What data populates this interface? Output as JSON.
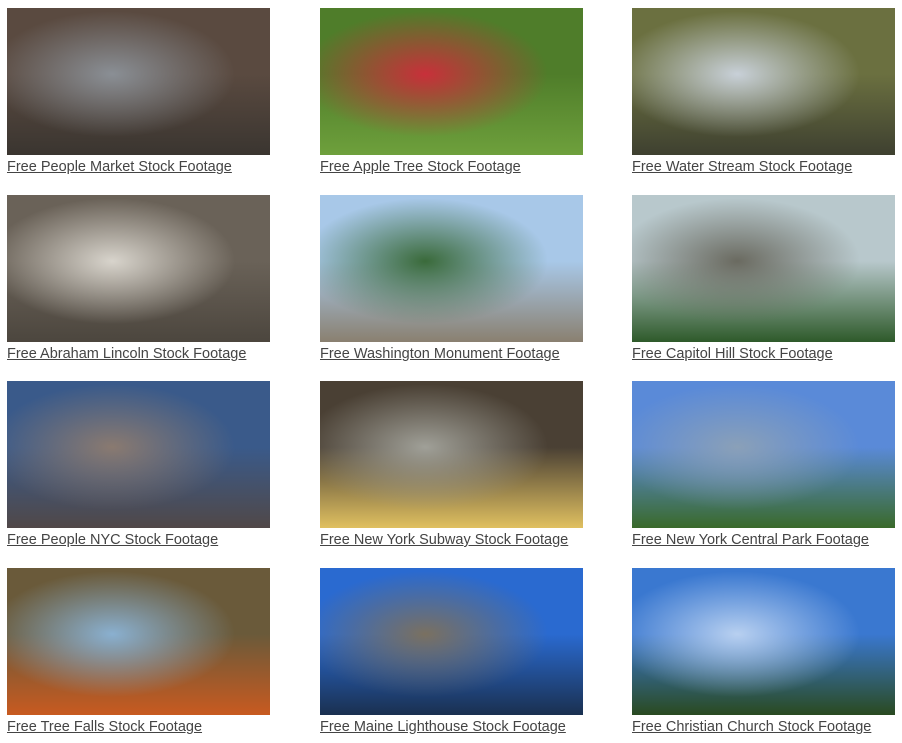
{
  "items": [
    {
      "title": "Free People Market Stock Footage",
      "colors": [
        "#5a4a40",
        "#8a8f95",
        "#3a3530"
      ]
    },
    {
      "title": "Free Apple Tree Stock Footage",
      "colors": [
        "#4f7d2a",
        "#c8303a",
        "#6ea03c"
      ]
    },
    {
      "title": "Free Water Stream Stock Footage",
      "colors": [
        "#6b7040",
        "#c8d0d8",
        "#3e4030"
      ]
    },
    {
      "title": "Free Abraham Lincoln Stock Footage",
      "colors": [
        "#6a6258",
        "#d8d4cc",
        "#4c463e"
      ]
    },
    {
      "title": "Free Washington Monument Footage",
      "colors": [
        "#a8c8e8",
        "#3a6a3a",
        "#8a8070"
      ]
    },
    {
      "title": "Free Capitol Hill Stock Footage",
      "colors": [
        "#b8c8cc",
        "#6a6a60",
        "#2e5a2a"
      ]
    },
    {
      "title": "Free People NYC Stock Footage",
      "colors": [
        "#3a5a8a",
        "#8a7a70",
        "#504848"
      ]
    },
    {
      "title": "Free New York Subway Stock Footage",
      "colors": [
        "#4a4034",
        "#a0a098",
        "#e0c060"
      ]
    },
    {
      "title": "Free New York Central Park Footage",
      "colors": [
        "#5a8ad8",
        "#8aa0b8",
        "#3a6a2a"
      ]
    },
    {
      "title": "Free Tree Falls Stock Footage",
      "colors": [
        "#6a5a3a",
        "#8ab0d0",
        "#c85a20"
      ]
    },
    {
      "title": "Free Maine Lighthouse Stock Footage",
      "colors": [
        "#2a6ad0",
        "#7a7060",
        "#1a3050"
      ]
    },
    {
      "title": "Free Christian Church Stock Footage",
      "colors": [
        "#3a78d0",
        "#b8d0f0",
        "#2a4a20"
      ]
    }
  ]
}
